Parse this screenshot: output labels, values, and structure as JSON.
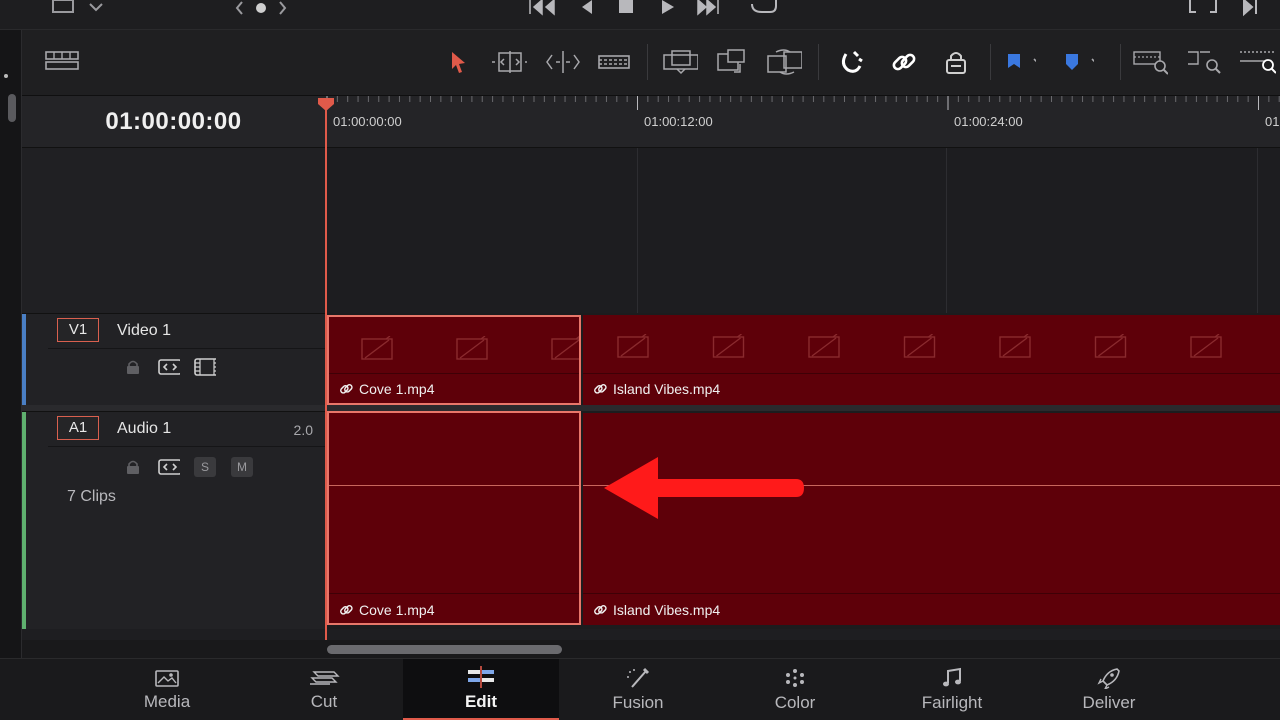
{
  "timecode": "01:00:00:00",
  "ruler": {
    "labels": [
      "01:00:00:00",
      "01:00:12:00",
      "01:00:24:00",
      "01"
    ]
  },
  "tracks": {
    "video": {
      "id": "V1",
      "name": "Video 1"
    },
    "audio": {
      "id": "A1",
      "name": "Audio 1",
      "channels": "2.0",
      "solo": "S",
      "mute": "M",
      "clip_count": "7 Clips"
    }
  },
  "clips": {
    "video": [
      {
        "name": "Cove 1.mp4"
      },
      {
        "name": "Island Vibes.mp4"
      }
    ],
    "audio": [
      {
        "name": "Cove 1.mp4"
      },
      {
        "name": "Island Vibes.mp4"
      }
    ]
  },
  "pages": [
    {
      "label": "Media",
      "icon": "media-icon"
    },
    {
      "label": "Cut",
      "icon": "cut-icon"
    },
    {
      "label": "Edit",
      "icon": "edit-icon",
      "active": true
    },
    {
      "label": "Fusion",
      "icon": "fusion-icon"
    },
    {
      "label": "Color",
      "icon": "color-icon"
    },
    {
      "label": "Fairlight",
      "icon": "fairlight-icon"
    },
    {
      "label": "Deliver",
      "icon": "deliver-icon"
    }
  ],
  "colors": {
    "clip": "#5e0009",
    "selection": "#e8776a",
    "playhead": "#e05a4a",
    "video_track": "#4a7fc4",
    "audio_track": "#5fb06f",
    "annotation_arrow": "#ff1a1a"
  }
}
